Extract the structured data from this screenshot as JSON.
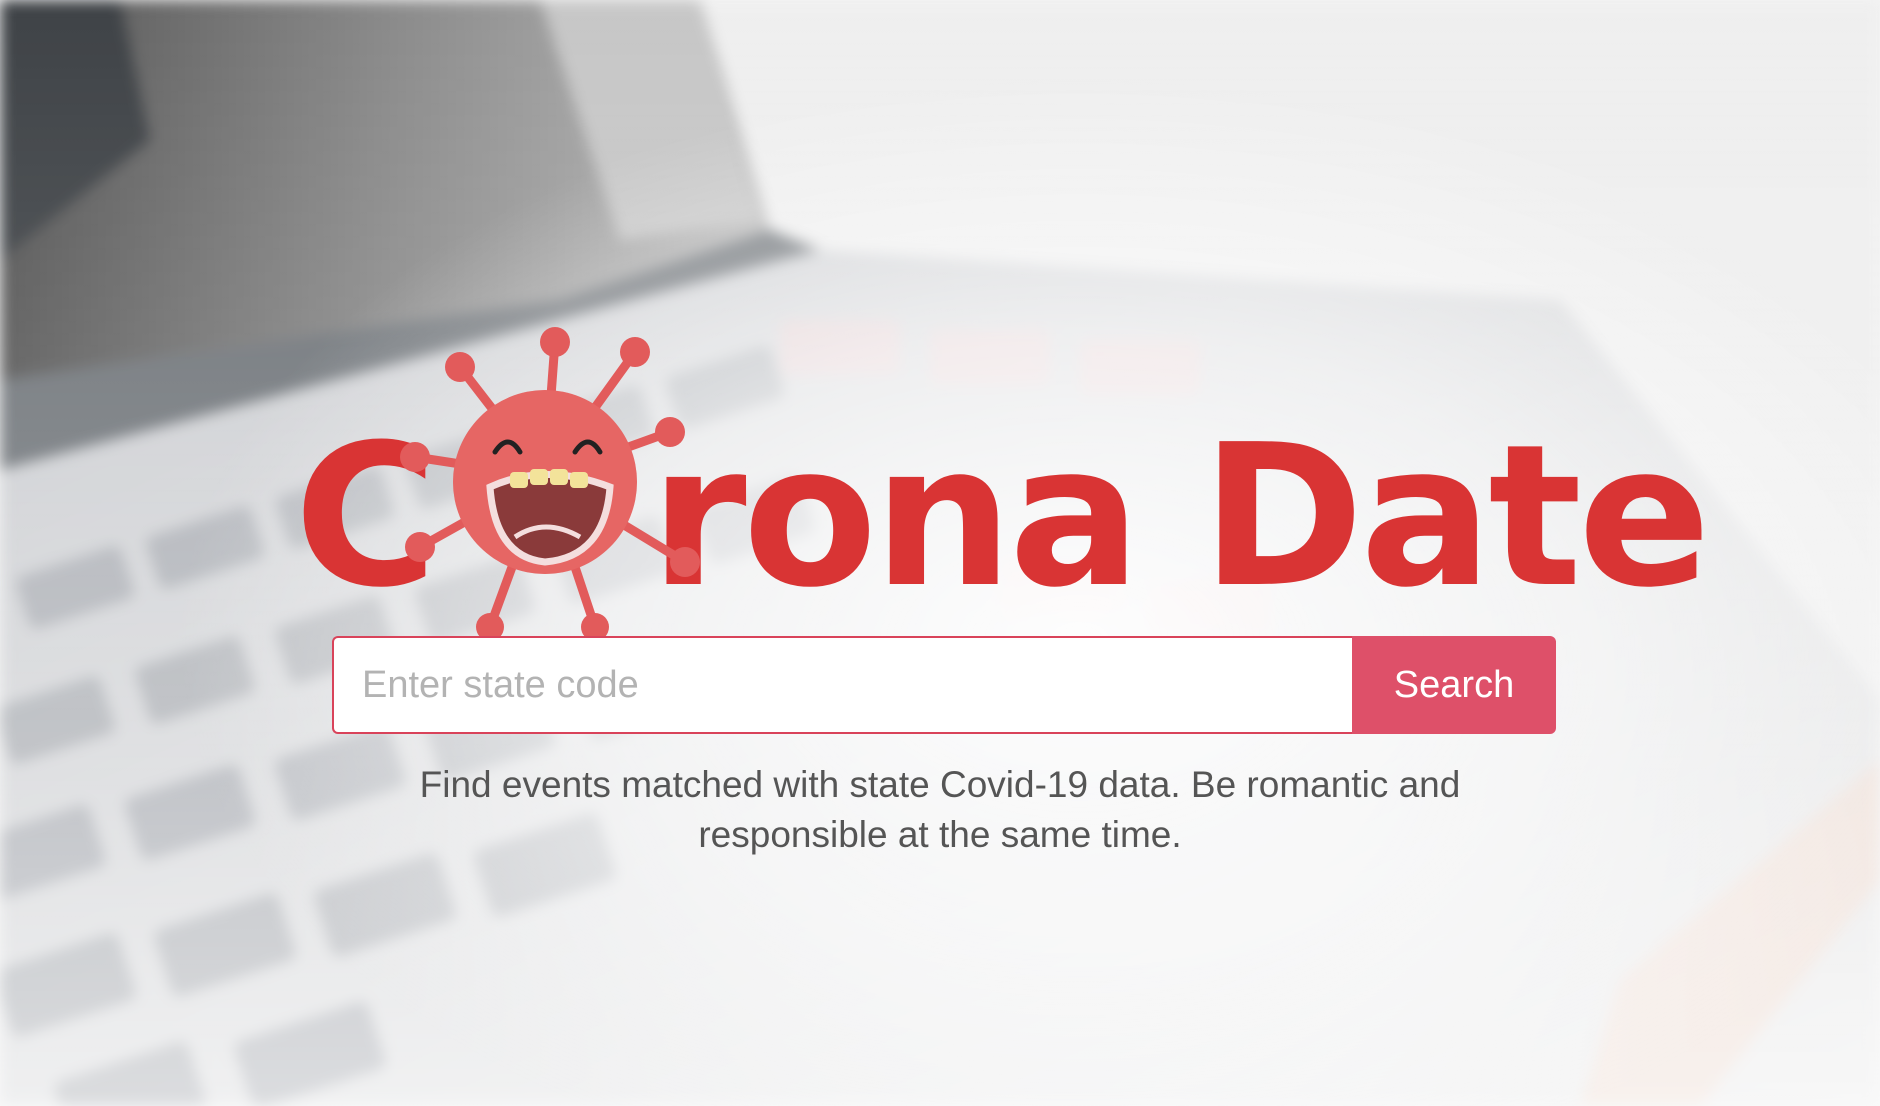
{
  "brand": {
    "name": "Corona Date",
    "logo_first_letter": "C",
    "logo_rest": "rona Date",
    "logo_color": "#d93434",
    "mascot_icon": "virus-mascot-icon"
  },
  "search": {
    "placeholder": "Enter state code",
    "value": "",
    "button_label": "Search",
    "border_color": "#d9435a",
    "button_color": "#de5069"
  },
  "tagline": "Find events matched with state Covid-19 data. Be romantic and responsible at the same time.",
  "background": {
    "icon": "laptop-keyboard-background"
  }
}
